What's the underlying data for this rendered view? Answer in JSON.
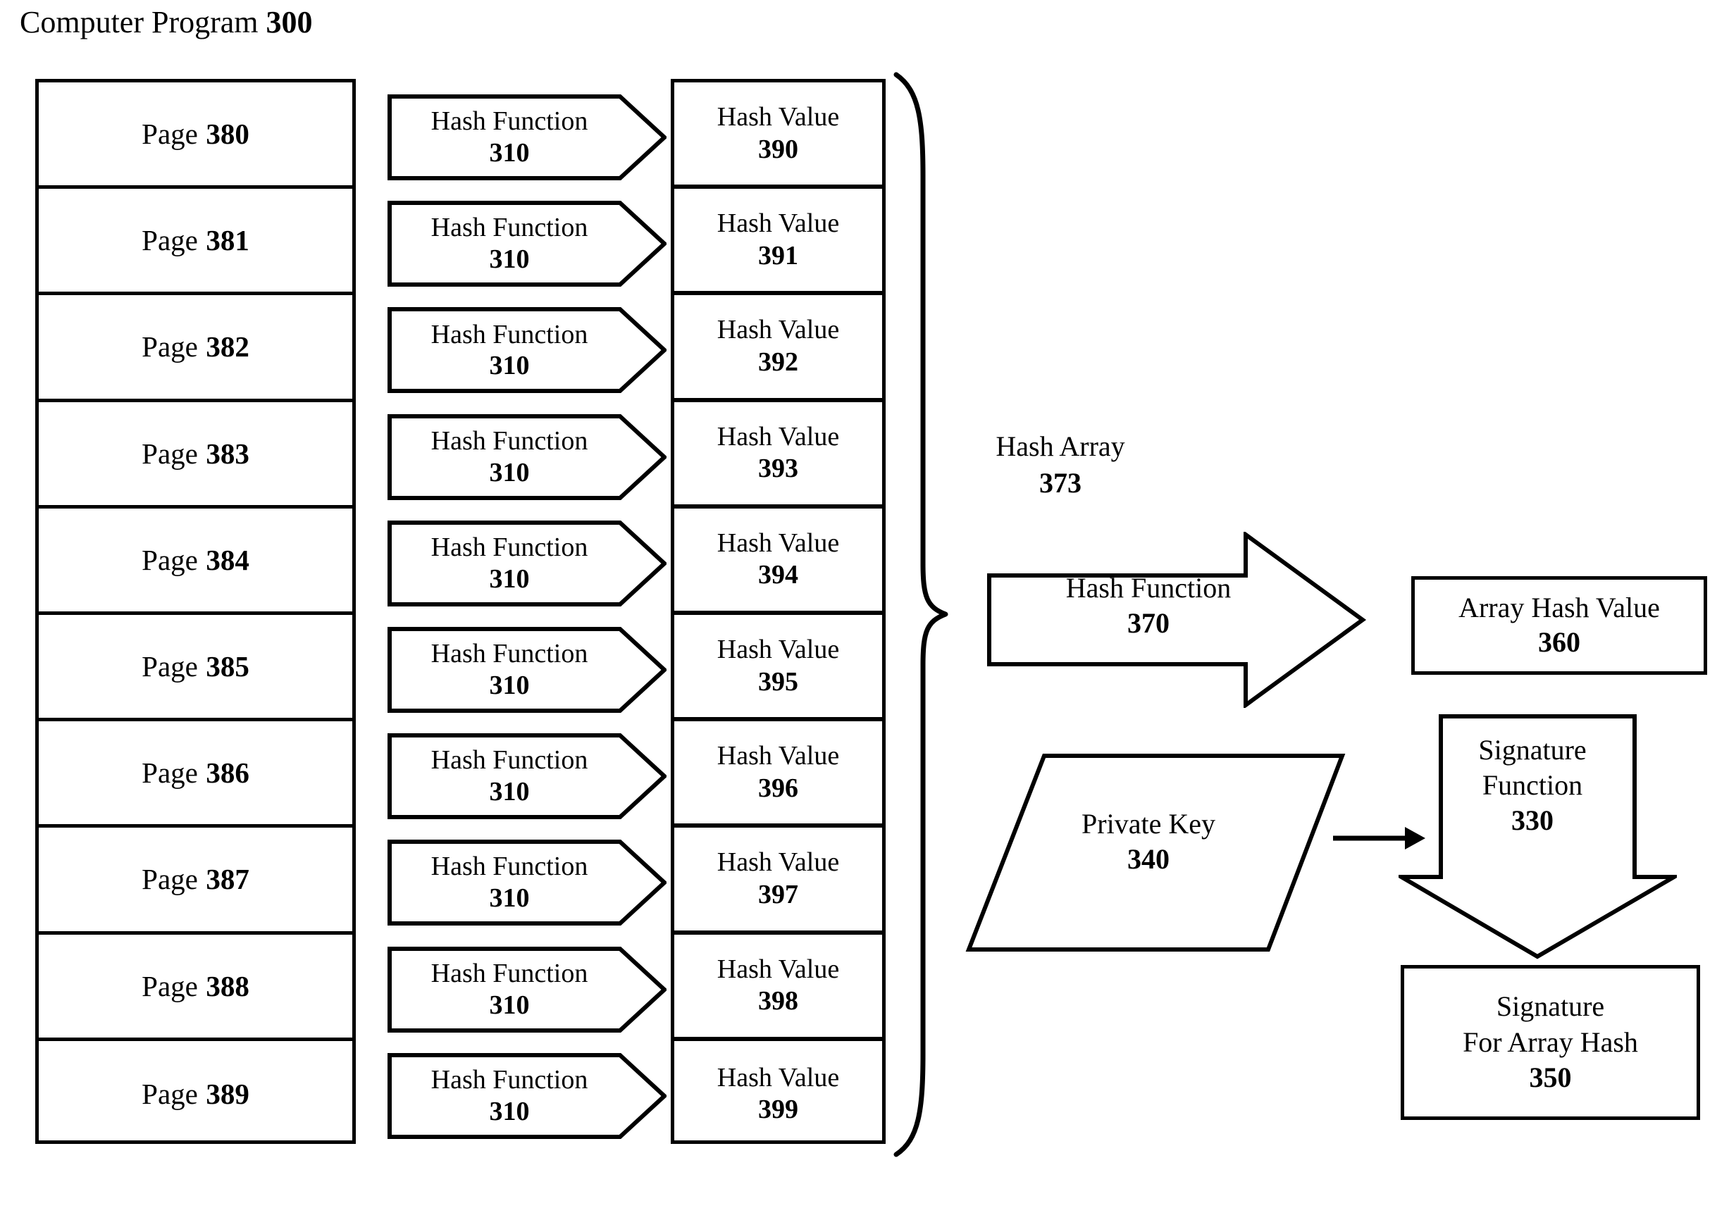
{
  "figure": {
    "title_text": "Computer Program",
    "title_number": "300"
  },
  "pages_column": {
    "label": "Page",
    "items": [
      {
        "label": "Page",
        "number": "380"
      },
      {
        "label": "Page",
        "number": "381"
      },
      {
        "label": "Page",
        "number": "382"
      },
      {
        "label": "Page",
        "number": "383"
      },
      {
        "label": "Page",
        "number": "384"
      },
      {
        "label": "Page",
        "number": "385"
      },
      {
        "label": "Page",
        "number": "386"
      },
      {
        "label": "Page",
        "number": "387"
      },
      {
        "label": "Page",
        "number": "388"
      },
      {
        "label": "Page",
        "number": "389"
      }
    ]
  },
  "hash_function_column": {
    "items": [
      {
        "label": "Hash Function",
        "number": "310"
      },
      {
        "label": "Hash Function",
        "number": "310"
      },
      {
        "label": "Hash Function",
        "number": "310"
      },
      {
        "label": "Hash Function",
        "number": "310"
      },
      {
        "label": "Hash Function",
        "number": "310"
      },
      {
        "label": "Hash Function",
        "number": "310"
      },
      {
        "label": "Hash Function",
        "number": "310"
      },
      {
        "label": "Hash Function",
        "number": "310"
      },
      {
        "label": "Hash Function",
        "number": "310"
      },
      {
        "label": "Hash Function",
        "number": "310"
      }
    ]
  },
  "hash_value_column": {
    "items": [
      {
        "label": "Hash Value",
        "number": "390"
      },
      {
        "label": "Hash Value",
        "number": "391"
      },
      {
        "label": "Hash Value",
        "number": "392"
      },
      {
        "label": "Hash Value",
        "number": "393"
      },
      {
        "label": "Hash Value",
        "number": "394"
      },
      {
        "label": "Hash Value",
        "number": "395"
      },
      {
        "label": "Hash Value",
        "number": "396"
      },
      {
        "label": "Hash Value",
        "number": "397"
      },
      {
        "label": "Hash Value",
        "number": "398"
      },
      {
        "label": "Hash Value",
        "number": "399"
      }
    ]
  },
  "hash_array": {
    "label": "Hash Array",
    "number": "373"
  },
  "hash_function_370": {
    "label": "Hash Function",
    "number": "370"
  },
  "array_hash_value": {
    "label": "Array Hash Value",
    "number": "360"
  },
  "private_key": {
    "label": "Private Key",
    "number": "340"
  },
  "signature_function": {
    "label_line1": "Signature",
    "label_line2": "Function",
    "number": "330"
  },
  "signature_for_array_hash": {
    "label_line1": "Signature",
    "label_line2": "For Array Hash",
    "number": "350"
  },
  "colors": {
    "stroke": "#000000",
    "background": "#ffffff"
  }
}
